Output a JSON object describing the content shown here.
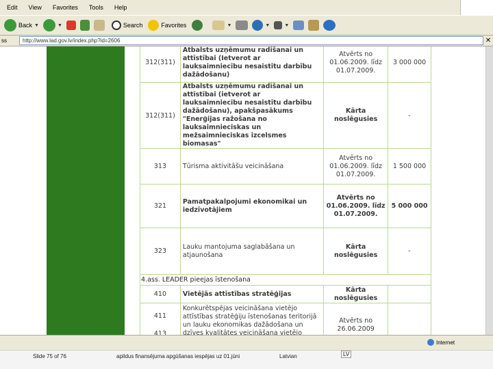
{
  "menubar": {
    "items": [
      "Edit",
      "View",
      "Favorites",
      "Tools",
      "Help"
    ]
  },
  "toolbar": {
    "back_label": "Back",
    "search_label": "Search",
    "favorites_label": "Favorites"
  },
  "addressbar": {
    "label": "ss",
    "url": "http://www.lad.gov.lv/index.php?id=2606"
  },
  "table": {
    "rows": [
      {
        "code": "312(311)",
        "desc": "Atbalsts uzņēmumu radīšanai un attīstībai (Ietverot ar lauksaimniecību nesaistītu darbību dažādošanu)",
        "status": "Atvērts no 01.06.2009. līdz 01.07.2009.",
        "amount": "3 000 000"
      },
      {
        "code": "312(311)",
        "desc": "Atbalsts uzņēmumu radīšanai un attīstībai (ietverot ar lauksaimniecību nesaistītu darbību dažādošanu), apakšpasākums \"Enerģijas ražošana no lauksaimnieciskas un mežsaimnieciskas izcelsmes biomasas\"",
        "status": "Kārta noslēgusies",
        "amount": "-"
      },
      {
        "code": "313",
        "desc": "Tūrisma aktivitāšu veicināšana",
        "status": "Atvērts no 01.06.2009. līdz 01.07.2009.",
        "amount": "1 500 000"
      },
      {
        "code": "321",
        "desc": "Pamatpakalpojumi ekonomikai un iedzīvotājiem",
        "status": "Atvērts no 01.06.2009. līdz 01.07.2009.",
        "amount": "5 000 000"
      },
      {
        "code": "323",
        "desc": "Lauku mantojuma saglabāšana un atjaunošana",
        "status": "Kārta noslēgusies",
        "amount": "-"
      }
    ],
    "section_title": "4.ass. LEADER pieejas īstenošana",
    "leader_rows": [
      {
        "code": "410",
        "desc": "Vietējās attīstības stratēģijas",
        "status": "Kārta noslēgusies"
      },
      {
        "code1": "411",
        "code2": "413",
        "desc": "Konkurētspējas veicināšana vietējo attīstības stratēģiju īstenošanas teritorijā un lauku ekonomikas dažādošana un dzīves kvalitātes veicināšana vietējo attīstības stratēģiju īstenošanas teritorijā",
        "status": "Atvērts no 26.06.2009"
      }
    ]
  },
  "statusbar": {
    "zone": "Internet"
  },
  "taskbar": {
    "slide": "Slide 75 of 76",
    "title": "apildus finansējuma apgūšanas iespējas uz 01.jūni",
    "language": "Latvian",
    "lang_badge": "LV"
  }
}
